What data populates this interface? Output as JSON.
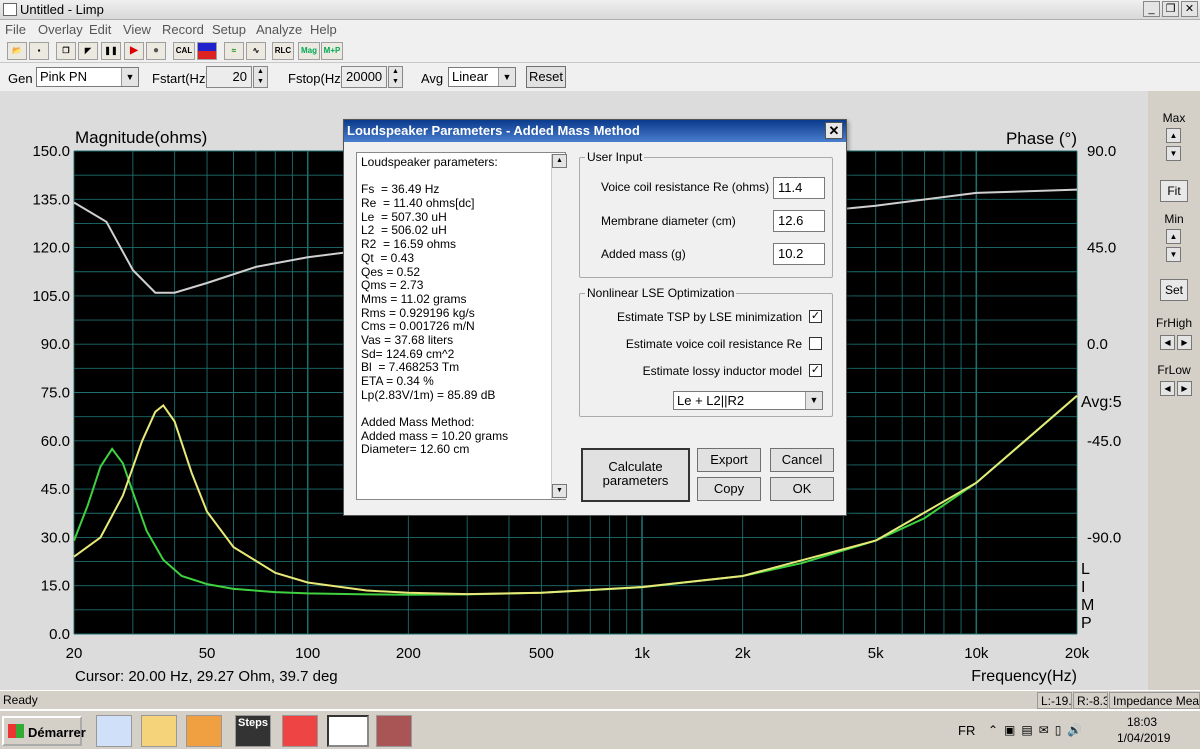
{
  "window": {
    "title": "Untitled - Limp",
    "min": "_",
    "restore": "❐",
    "close": "✕"
  },
  "menu": [
    "File",
    "Overlay",
    "Edit",
    "View",
    "Record",
    "Setup",
    "Analyze",
    "Help"
  ],
  "toolbar": {
    "cal": "CAL",
    "rlc": "RLC",
    "mag": "Mag",
    "mp": "M+P"
  },
  "controls": {
    "gen_label": "Gen",
    "gen_value": "Pink PN",
    "fstart_label": "Fstart(Hz)",
    "fstart_value": "20",
    "fstop_label": "Fstop(Hz)",
    "fstop_value": "20000",
    "avg_label": "Avg",
    "avg_value": "Linear",
    "reset": "Reset"
  },
  "plot": {
    "ylabel_left": "Magnitude(ohms)",
    "ylabel_right": "Phase (°)",
    "xlabel": "Frequency(Hz)",
    "avg_text": "Avg:5",
    "cursor": "Cursor: 20.00 Hz, 29.27 Ohm, 39.7 deg",
    "limp": [
      "L",
      "I",
      "M",
      "P"
    ]
  },
  "chart_data": {
    "type": "line",
    "xscale": "log",
    "xlim": [
      20,
      20000
    ],
    "ylim_left": [
      0,
      150
    ],
    "ylim_right": [
      -135,
      90
    ],
    "x_ticks": [
      "20",
      "50",
      "100",
      "200",
      "500",
      "1k",
      "2k",
      "5k",
      "10k",
      "20k"
    ],
    "y_ticks_left": [
      "150.0",
      "135.0",
      "120.0",
      "105.0",
      "90.0",
      "75.0",
      "60.0",
      "45.0",
      "30.0",
      "15.0",
      "0.0"
    ],
    "y_ticks_right": [
      "90.0",
      "45.0",
      "0.0",
      "-45.0",
      "-90.0"
    ],
    "grid": true,
    "series": [
      {
        "color": "#3fd13f",
        "x": [
          20,
          22,
          24,
          26,
          28,
          30,
          33,
          37,
          42,
          50,
          60,
          80,
          100,
          150,
          200,
          300,
          500,
          1000,
          2000,
          3000,
          5000,
          7000,
          10000,
          14000,
          20000
        ],
        "y": [
          29,
          40,
          52,
          57.5,
          53,
          44,
          32,
          23,
          18,
          15.5,
          14,
          13,
          12.6,
          12.3,
          12.2,
          12.3,
          12.8,
          14.5,
          18,
          22,
          29,
          36,
          47,
          60,
          74
        ]
      },
      {
        "color": "#e8e878",
        "x": [
          20,
          24,
          28,
          32,
          35,
          37,
          40,
          45,
          50,
          60,
          80,
          100,
          150,
          200,
          300,
          500,
          1000,
          2000,
          5000,
          10000,
          20000
        ],
        "y": [
          24,
          30,
          43,
          60,
          69,
          71,
          66,
          50,
          38,
          27,
          19,
          16,
          13.5,
          12.8,
          12.4,
          12.8,
          14.6,
          18,
          29,
          47,
          74
        ]
      },
      {
        "color": "#d0d0d0",
        "x": [
          20,
          25,
          30,
          35,
          40,
          50,
          70,
          100,
          200,
          500,
          1000,
          2000,
          5000,
          10000,
          20000
        ],
        "y": [
          134,
          128,
          113,
          106,
          106,
          109,
          114,
          117,
          121,
          125,
          127,
          129,
          133,
          137,
          138
        ]
      }
    ]
  },
  "right_panel": {
    "max": "Max",
    "fit": "Fit",
    "min": "Min",
    "set": "Set",
    "frhigh": "FrHigh",
    "frlow": "FrLow"
  },
  "status": {
    "ready": "Ready",
    "c1": "L:-19.",
    "c2": "R:-8.3",
    "c3": "Impedance Meas"
  },
  "taskbar": {
    "start": "Démarrer",
    "lang": "FR",
    "time": "18:03",
    "date": "1/04/2019",
    "steps": "Steps"
  },
  "dialog": {
    "title": "Loudspeaker Parameters - Added Mass Method",
    "close": "✕",
    "params": [
      "Loudspeaker parameters:",
      "",
      "Fs  = 36.49 Hz",
      "Re  = 11.40 ohms[dc]",
      "Le  = 507.30 uH",
      "L2  = 506.02 uH",
      "R2  = 16.59 ohms",
      "Qt  = 0.43",
      "Qes = 0.52",
      "Qms = 2.73",
      "Mms = 11.02 grams",
      "Rms = 0.929196 kg/s",
      "Cms = 0.001726 m/N",
      "Vas = 37.68 liters",
      "Sd= 124.69 cm^2",
      "Bl  = 7.468253 Tm",
      "ETA = 0.34 %",
      "Lp(2.83V/1m) = 85.89 dB",
      "",
      "Added Mass Method:",
      "Added mass = 10.20 grams",
      "Diameter= 12.60 cm"
    ],
    "user_input": {
      "title": "User Input",
      "re_label": "Voice coil resistance Re (ohms)",
      "re_value": "11.4",
      "diam_label": "Membrane diameter (cm)",
      "diam_value": "12.6",
      "mass_label": "Added mass (g)",
      "mass_value": "10.2"
    },
    "lse": {
      "title": "Nonlinear LSE Optimization",
      "opt1": "Estimate TSP by LSE minimization",
      "opt1_checked": "✓",
      "opt2": "Estimate voice coil resistance Re",
      "opt2_checked": "",
      "opt3": "Estimate lossy inductor model",
      "opt3_checked": "✓",
      "model": "Le + L2||R2"
    },
    "buttons": {
      "calc1": "Calculate",
      "calc2": "parameters",
      "export": "Export",
      "cancel": "Cancel",
      "copy": "Copy",
      "ok": "OK"
    }
  }
}
